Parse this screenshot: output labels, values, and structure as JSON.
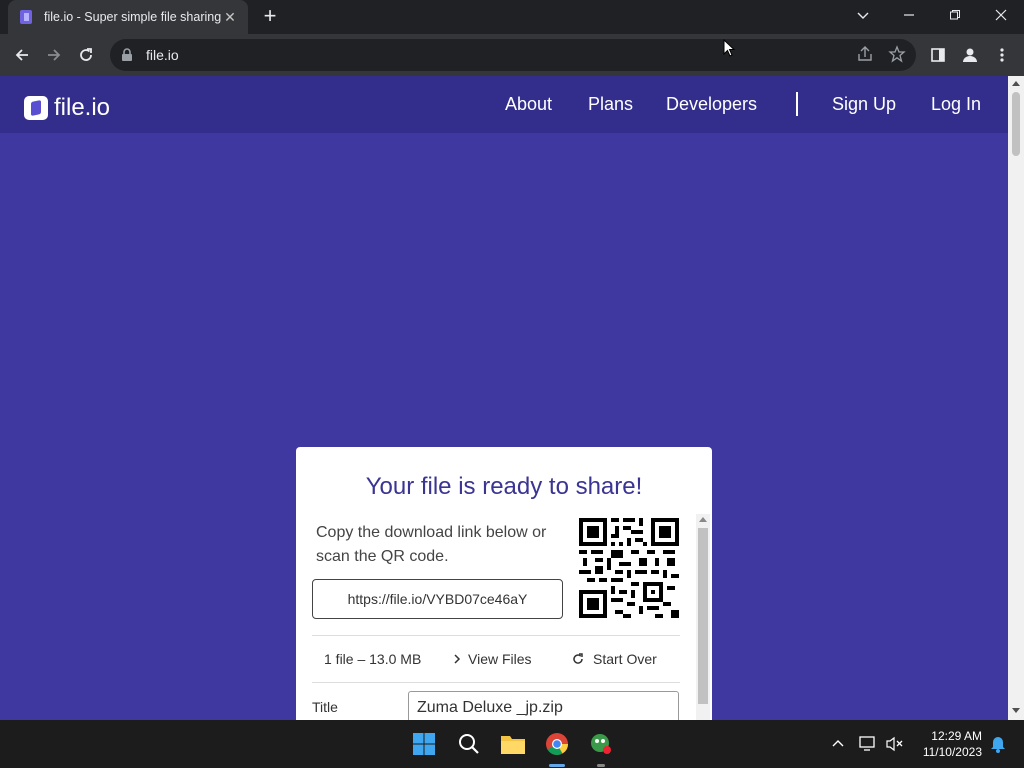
{
  "browser": {
    "tab_title": "file.io - Super simple file sharing",
    "url": "file.io"
  },
  "site": {
    "logo_text": "file.io",
    "nav": [
      "About",
      "Plans",
      "Developers",
      "Sign Up",
      "Log In"
    ]
  },
  "card": {
    "heading": "Your file is ready to share!",
    "description": "Copy the download link below or scan the QR code.",
    "link": "https://file.io/VYBD07ce46aY",
    "file_count": "1 file – 13.0 MB",
    "view_files": "View Files",
    "start_over": "Start Over",
    "title_label": "Title",
    "title_value": "Zuma Deluxe _jp.zip"
  },
  "taskbar": {
    "time": "12:29 AM",
    "date": "11/10/2023"
  },
  "colors": {
    "page_bg": "#3e38a0",
    "nav_bg": "#332e8c",
    "heading": "#3a3493"
  }
}
